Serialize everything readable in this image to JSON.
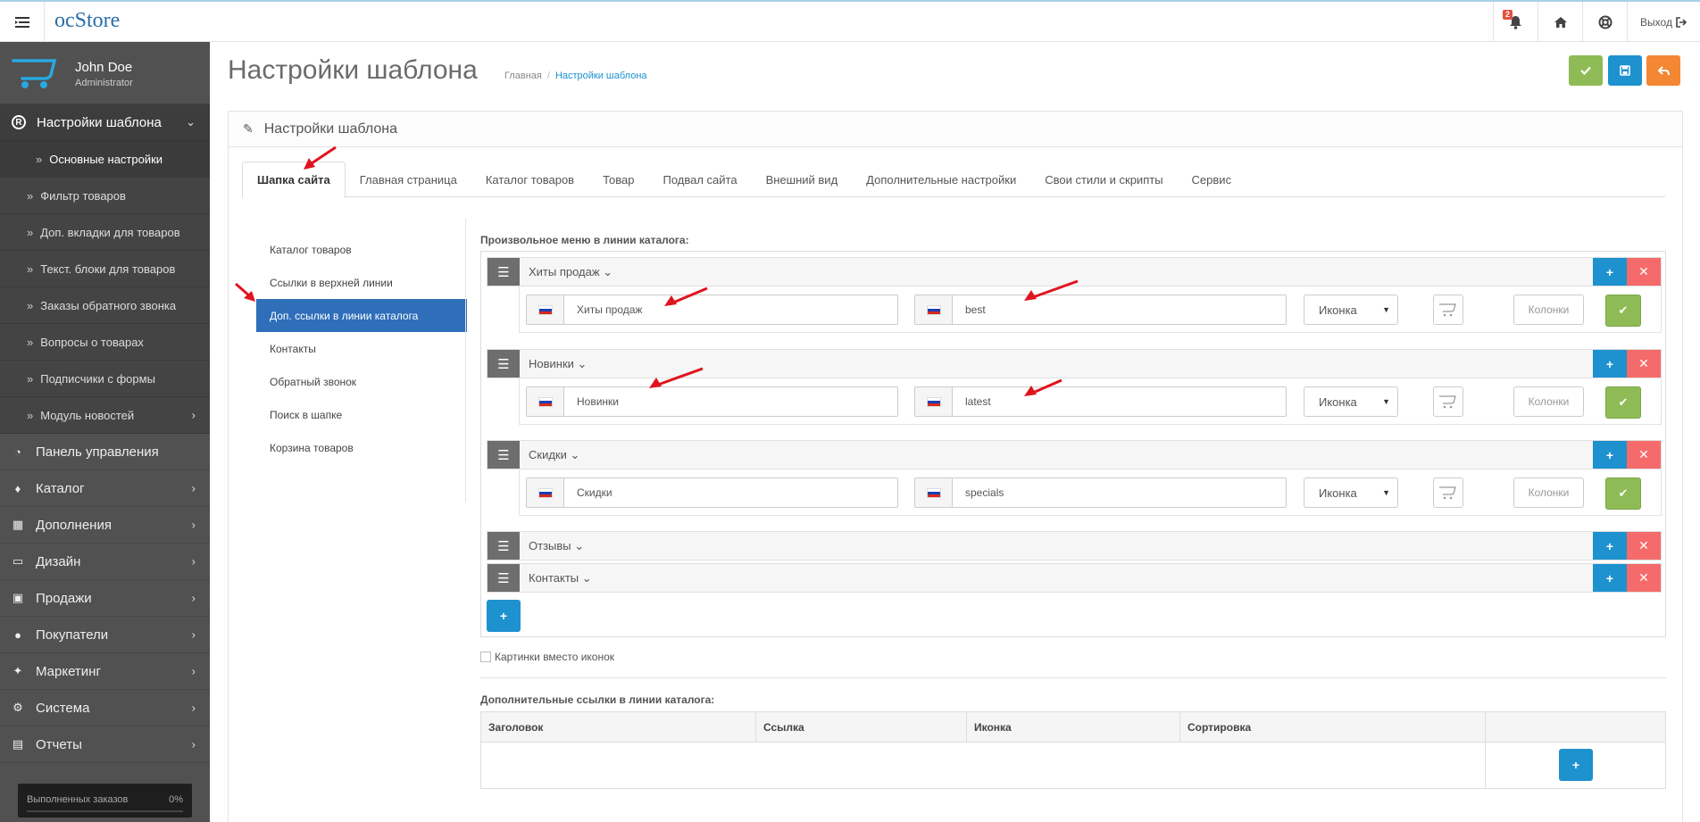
{
  "header": {
    "logo": "ocStore",
    "notification_count": "2",
    "logout_label": "Выход"
  },
  "sidebar": {
    "user_name": "John Doe",
    "user_role": "Administrator",
    "section": "Настройки шаблона",
    "subitems": [
      {
        "label": "Основные настройки"
      },
      {
        "label": "Фильтр товаров"
      },
      {
        "label": "Доп. вкладки для товаров"
      },
      {
        "label": "Текст. блоки для товаров"
      },
      {
        "label": "Заказы обратного звонка"
      },
      {
        "label": "Вопросы о товарах"
      },
      {
        "label": "Подписчики с формы"
      },
      {
        "label": "Модуль новостей"
      }
    ],
    "items": [
      {
        "label": "Панель управления",
        "icon": "dashboard-icon"
      },
      {
        "label": "Каталог",
        "icon": "tag-icon"
      },
      {
        "label": "Дополнения",
        "icon": "puzzle-icon"
      },
      {
        "label": "Дизайн",
        "icon": "monitor-icon"
      },
      {
        "label": "Продажи",
        "icon": "cart-icon"
      },
      {
        "label": "Покупатели",
        "icon": "user-icon"
      },
      {
        "label": "Маркетинг",
        "icon": "share-icon"
      },
      {
        "label": "Система",
        "icon": "gear-icon"
      },
      {
        "label": "Отчеты",
        "icon": "bar-chart-icon"
      }
    ],
    "progress_label": "Выполненных заказов",
    "progress_value": "0%"
  },
  "page": {
    "title": "Настройки шаблона",
    "breadcrumb_home": "Главная",
    "breadcrumb_current": "Настройки шаблона",
    "panel_title": "Настройки шаблона"
  },
  "tabs": [
    "Шапка сайта",
    "Главная страница",
    "Каталог товаров",
    "Товар",
    "Подвал сайта",
    "Внешний вид",
    "Дополнительные настройки",
    "Свои стили и скрипты",
    "Сервис"
  ],
  "vnav": [
    "Каталог товаров",
    "Ссылки в верхней линии",
    "Доп. ссылки в линии каталога",
    "Контакты",
    "Обратный звонок",
    "Поиск в шапке",
    "Корзина товаров"
  ],
  "menu_section_title": "Произвольное меню в линии каталога:",
  "menu_rows": [
    {
      "title": "Хиты продаж",
      "name_value": "Хиты продаж",
      "link_value": "best",
      "icon_select": "Иконка",
      "columns_placeholder": "Колонки"
    },
    {
      "title": "Новинки",
      "name_value": "Новинки",
      "link_value": "latest",
      "icon_select": "Иконка",
      "columns_placeholder": "Колонки"
    },
    {
      "title": "Скидки",
      "name_value": "Скидки",
      "link_value": "specials",
      "icon_select": "Иконка",
      "columns_placeholder": "Колонки"
    },
    {
      "title": "Отзывы"
    },
    {
      "title": "Контакты"
    }
  ],
  "checkbox_label": "Картинки вместо иконок",
  "links_section_title": "Дополнительные ссылки в линии каталога:",
  "links_table_headers": [
    "Заголовок",
    "Ссылка",
    "Иконка",
    "Сортировка"
  ],
  "colors": {
    "sidebar_bg": "#515151",
    "primary": "#1e91cf",
    "success": "#8fbb56",
    "danger": "#f56b6b",
    "warning": "#f38733",
    "active_nav": "#2f6eb9",
    "annotation_arrow": "#e0141e"
  }
}
